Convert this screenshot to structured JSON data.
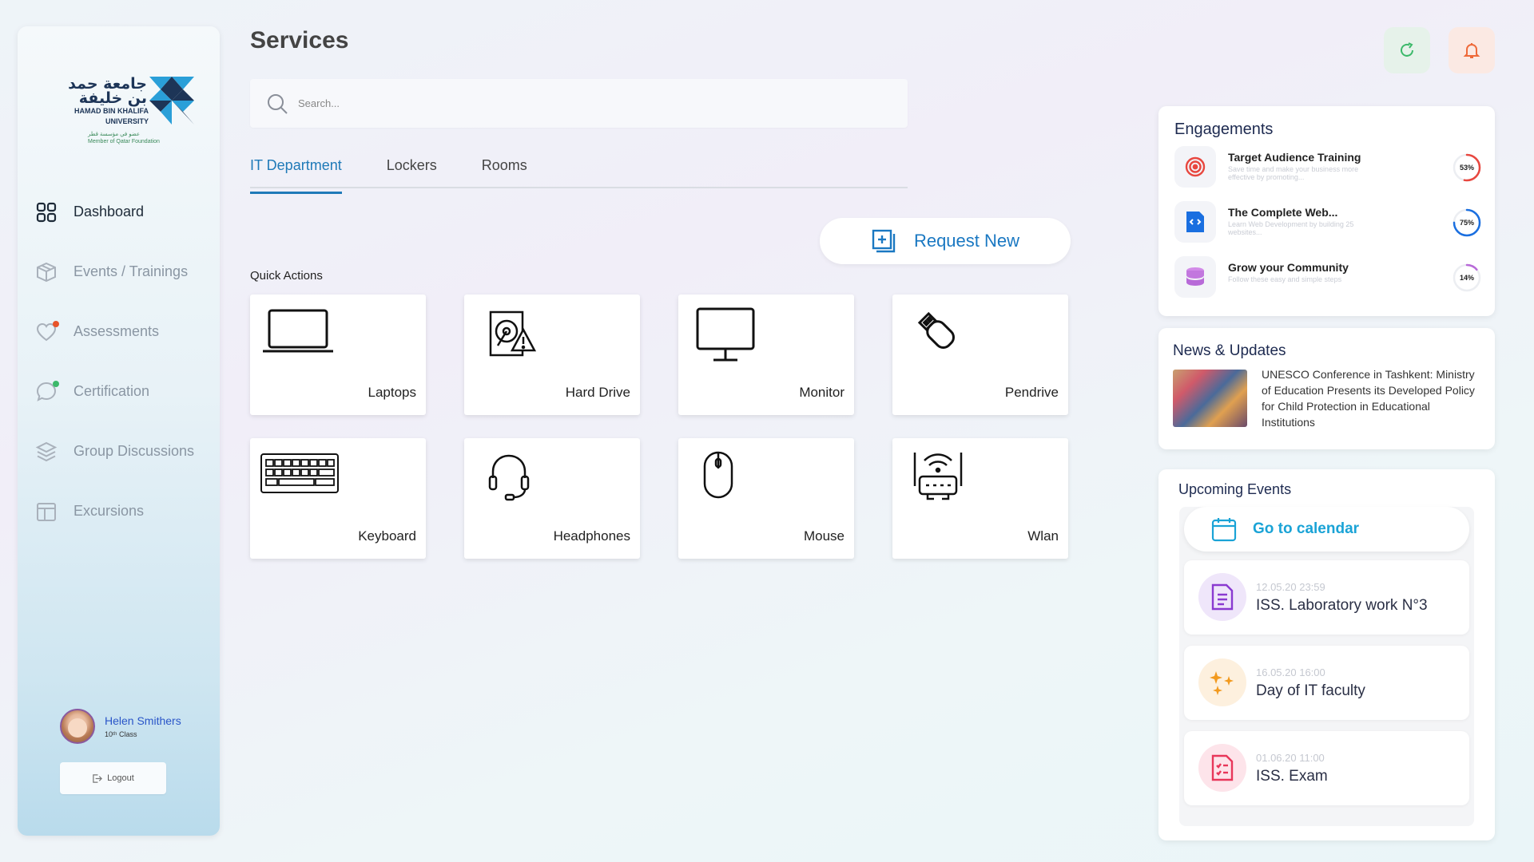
{
  "sidebar": {
    "logo": {
      "arabic": "جامعة حمد بن خليفة",
      "english_line1": "HAMAD BIN KHALIFA",
      "english_line2": "UNIVERSITY",
      "member_arabic": "عضو في مؤسسة قطر",
      "member_english": "Member of Qatar Foundation"
    },
    "items": [
      {
        "label": "Dashboard",
        "icon": "grid-icon",
        "active": true
      },
      {
        "label": "Events / Trainings",
        "icon": "box-icon",
        "active": false
      },
      {
        "label": "Assessments",
        "icon": "heart-icon",
        "active": false,
        "badge_color": "#e8542a"
      },
      {
        "label": "Certification",
        "icon": "chat-bubble-icon",
        "active": false,
        "badge_color": "#3cb96a"
      },
      {
        "label": "Group Discussions",
        "icon": "layers-icon",
        "active": false
      },
      {
        "label": "Excursions",
        "icon": "calendar-icon",
        "active": false
      }
    ],
    "user": {
      "name": "Helen Smithers",
      "class": "10ᵗʰ Class"
    },
    "logout_label": "Logout"
  },
  "header": {
    "title": "Services",
    "search_placeholder": "Search...",
    "tabs": [
      {
        "label": "IT Department",
        "active": true
      },
      {
        "label": "Lockers",
        "active": false
      },
      {
        "label": "Rooms",
        "active": false
      }
    ]
  },
  "main": {
    "request_button": "Request New",
    "quick_actions_label": "Quick Actions",
    "quick_actions": [
      {
        "label": "Laptops",
        "icon": "laptop-icon"
      },
      {
        "label": "Hard Drive",
        "icon": "hard-drive-warning-icon"
      },
      {
        "label": "Monitor",
        "icon": "monitor-icon"
      },
      {
        "label": "Pendrive",
        "icon": "usb-drive-icon"
      },
      {
        "label": "Keyboard",
        "icon": "keyboard-icon"
      },
      {
        "label": "Headphones",
        "icon": "headset-icon"
      },
      {
        "label": "Mouse",
        "icon": "mouse-icon"
      },
      {
        "label": "Wlan",
        "icon": "wifi-router-icon"
      }
    ]
  },
  "engagements": {
    "title": "Engagements",
    "items": [
      {
        "name": "Target Audience Training",
        "desc": "Save time and make your business more effective by promoting...",
        "percent": 53,
        "pct_label": "53%",
        "color": "#e8473f",
        "icon": "target-icon"
      },
      {
        "name": "The Complete Web...",
        "desc": "Learn Web Development by building 25 websites...",
        "percent": 75,
        "pct_label": "75%",
        "color": "#1a6fe0",
        "icon": "code-file-icon"
      },
      {
        "name": "Grow your Community",
        "desc": "Follow these easy and simple steps",
        "percent": 14,
        "pct_label": "14%",
        "color": "#b86ad8",
        "icon": "database-icon"
      }
    ]
  },
  "news": {
    "title": "News & Updates",
    "headline": "UNESCO Conference in Tashkent: Ministry of Education Presents its Developed Policy for Child Protection in Educational Institutions"
  },
  "events": {
    "title": "Upcoming Events",
    "calendar_label": "Go to calendar",
    "items": [
      {
        "date": "12.05.20 23:59",
        "name": "ISS. Laboratory work N°3",
        "color": "#8a3ad0",
        "bg": "#efe6fa",
        "icon": "document-icon"
      },
      {
        "date": "16.05.20 16:00",
        "name": "Day of IT faculty",
        "color": "#f29a1e",
        "bg": "#fdf0de",
        "icon": "sparkles-icon"
      },
      {
        "date": "01.06.20 11:00",
        "name": "ISS. Exam",
        "color": "#e8375a",
        "bg": "#fde4ea",
        "icon": "checklist-icon"
      }
    ]
  }
}
